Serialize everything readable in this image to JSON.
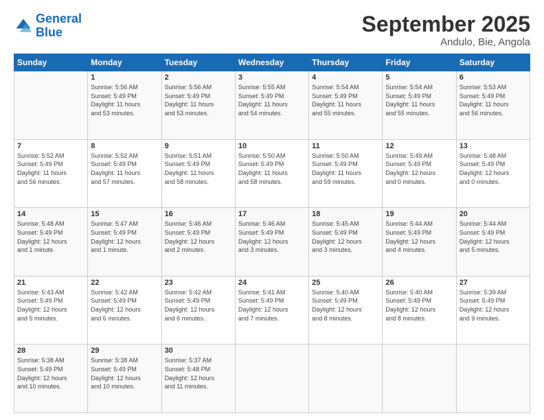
{
  "header": {
    "logo_line1": "General",
    "logo_line2": "Blue",
    "title": "September 2025",
    "subtitle": "Andulo, Bie, Angola"
  },
  "days_of_week": [
    "Sunday",
    "Monday",
    "Tuesday",
    "Wednesday",
    "Thursday",
    "Friday",
    "Saturday"
  ],
  "weeks": [
    [
      {
        "day": "",
        "text": ""
      },
      {
        "day": "1",
        "text": "Sunrise: 5:56 AM\nSunset: 5:49 PM\nDaylight: 11 hours\nand 53 minutes."
      },
      {
        "day": "2",
        "text": "Sunrise: 5:56 AM\nSunset: 5:49 PM\nDaylight: 11 hours\nand 53 minutes."
      },
      {
        "day": "3",
        "text": "Sunrise: 5:55 AM\nSunset: 5:49 PM\nDaylight: 11 hours\nand 54 minutes."
      },
      {
        "day": "4",
        "text": "Sunrise: 5:54 AM\nSunset: 5:49 PM\nDaylight: 11 hours\nand 55 minutes."
      },
      {
        "day": "5",
        "text": "Sunrise: 5:54 AM\nSunset: 5:49 PM\nDaylight: 11 hours\nand 55 minutes."
      },
      {
        "day": "6",
        "text": "Sunrise: 5:53 AM\nSunset: 5:49 PM\nDaylight: 11 hours\nand 56 minutes."
      }
    ],
    [
      {
        "day": "7",
        "text": "Sunrise: 5:52 AM\nSunset: 5:49 PM\nDaylight: 11 hours\nand 56 minutes."
      },
      {
        "day": "8",
        "text": "Sunrise: 5:52 AM\nSunset: 5:49 PM\nDaylight: 11 hours\nand 57 minutes."
      },
      {
        "day": "9",
        "text": "Sunrise: 5:51 AM\nSunset: 5:49 PM\nDaylight: 11 hours\nand 58 minutes."
      },
      {
        "day": "10",
        "text": "Sunrise: 5:50 AM\nSunset: 5:49 PM\nDaylight: 11 hours\nand 58 minutes."
      },
      {
        "day": "11",
        "text": "Sunrise: 5:50 AM\nSunset: 5:49 PM\nDaylight: 11 hours\nand 59 minutes."
      },
      {
        "day": "12",
        "text": "Sunrise: 5:49 AM\nSunset: 5:49 PM\nDaylight: 12 hours\nand 0 minutes."
      },
      {
        "day": "13",
        "text": "Sunrise: 5:48 AM\nSunset: 5:49 PM\nDaylight: 12 hours\nand 0 minutes."
      }
    ],
    [
      {
        "day": "14",
        "text": "Sunrise: 5:48 AM\nSunset: 5:49 PM\nDaylight: 12 hours\nand 1 minute."
      },
      {
        "day": "15",
        "text": "Sunrise: 5:47 AM\nSunset: 5:49 PM\nDaylight: 12 hours\nand 1 minute."
      },
      {
        "day": "16",
        "text": "Sunrise: 5:46 AM\nSunset: 5:49 PM\nDaylight: 12 hours\nand 2 minutes."
      },
      {
        "day": "17",
        "text": "Sunrise: 5:46 AM\nSunset: 5:49 PM\nDaylight: 12 hours\nand 3 minutes."
      },
      {
        "day": "18",
        "text": "Sunrise: 5:45 AM\nSunset: 5:49 PM\nDaylight: 12 hours\nand 3 minutes."
      },
      {
        "day": "19",
        "text": "Sunrise: 5:44 AM\nSunset: 5:49 PM\nDaylight: 12 hours\nand 4 minutes."
      },
      {
        "day": "20",
        "text": "Sunrise: 5:44 AM\nSunset: 5:49 PM\nDaylight: 12 hours\nand 5 minutes."
      }
    ],
    [
      {
        "day": "21",
        "text": "Sunrise: 5:43 AM\nSunset: 5:49 PM\nDaylight: 12 hours\nand 5 minutes."
      },
      {
        "day": "22",
        "text": "Sunrise: 5:42 AM\nSunset: 5:49 PM\nDaylight: 12 hours\nand 6 minutes."
      },
      {
        "day": "23",
        "text": "Sunrise: 5:42 AM\nSunset: 5:49 PM\nDaylight: 12 hours\nand 6 minutes."
      },
      {
        "day": "24",
        "text": "Sunrise: 5:41 AM\nSunset: 5:49 PM\nDaylight: 12 hours\nand 7 minutes."
      },
      {
        "day": "25",
        "text": "Sunrise: 5:40 AM\nSunset: 5:49 PM\nDaylight: 12 hours\nand 8 minutes."
      },
      {
        "day": "26",
        "text": "Sunrise: 5:40 AM\nSunset: 5:49 PM\nDaylight: 12 hours\nand 8 minutes."
      },
      {
        "day": "27",
        "text": "Sunrise: 5:39 AM\nSunset: 5:49 PM\nDaylight: 12 hours\nand 9 minutes."
      }
    ],
    [
      {
        "day": "28",
        "text": "Sunrise: 5:38 AM\nSunset: 5:49 PM\nDaylight: 12 hours\nand 10 minutes."
      },
      {
        "day": "29",
        "text": "Sunrise: 5:38 AM\nSunset: 5:49 PM\nDaylight: 12 hours\nand 10 minutes."
      },
      {
        "day": "30",
        "text": "Sunrise: 5:37 AM\nSunset: 5:48 PM\nDaylight: 12 hours\nand 11 minutes."
      },
      {
        "day": "",
        "text": ""
      },
      {
        "day": "",
        "text": ""
      },
      {
        "day": "",
        "text": ""
      },
      {
        "day": "",
        "text": ""
      }
    ]
  ]
}
